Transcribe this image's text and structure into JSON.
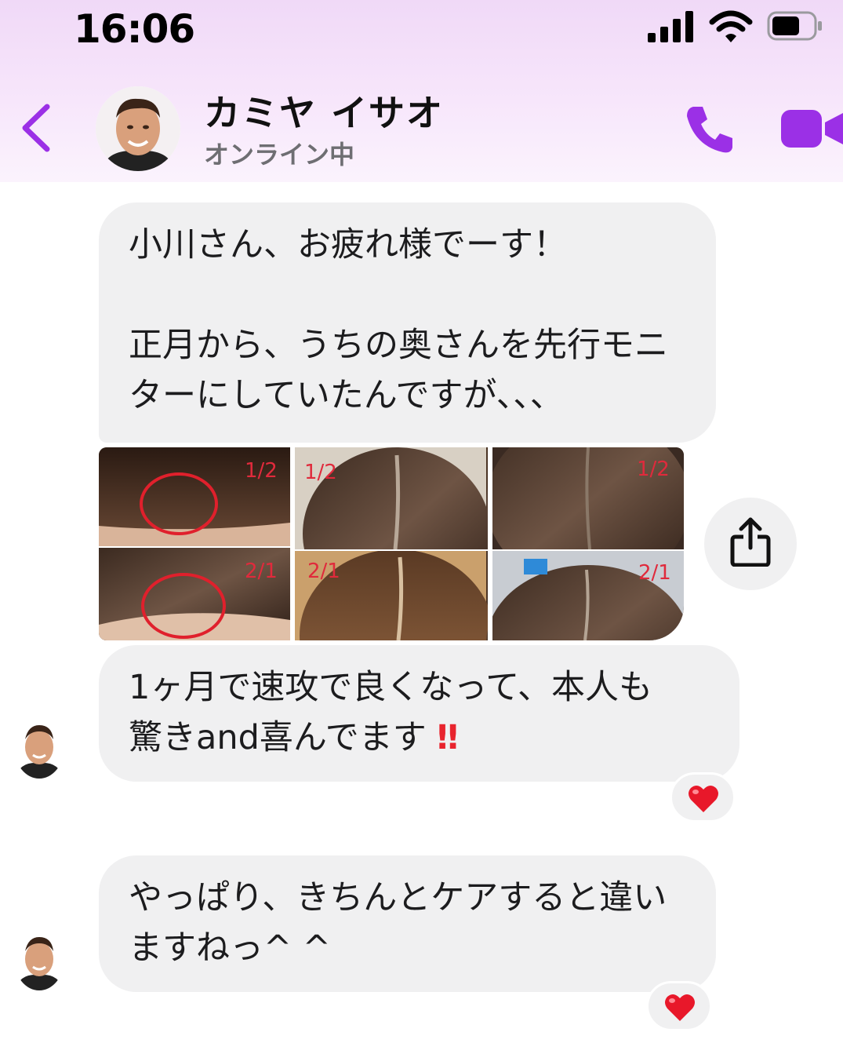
{
  "status_bar": {
    "time": "16:06"
  },
  "header": {
    "contact_name": "カミヤ イサオ",
    "contact_status": "オンライン中",
    "icons": {
      "back": "chevron-left-icon",
      "phone": "phone-icon",
      "video": "video-camera-icon"
    },
    "accent_color": "#9b30e6"
  },
  "messages": [
    {
      "type": "text",
      "text": "小川さん、お疲れ様でーす！\n\n正月から、うちの奥さんを先行モニターにしていたんですが、、、"
    },
    {
      "type": "photo",
      "labels": [
        "1/2",
        "1/2",
        "1/2",
        "2/1",
        "2/1",
        "2/1"
      ]
    },
    {
      "type": "text",
      "text_main": "1ヶ月で速攻で良くなって、本人も\n驚きand喜んでます",
      "text_emoji": "‼",
      "reaction": "❤️"
    },
    {
      "type": "text",
      "text": "やっぱり、きちんとケアすると違いますねっ^ ^",
      "reaction": "❤️"
    }
  ],
  "share_icon": "share-icon"
}
